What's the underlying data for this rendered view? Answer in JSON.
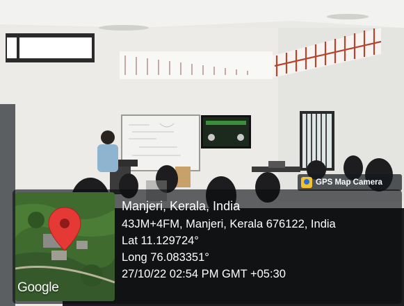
{
  "badge": {
    "icon": "gps-map-camera-icon",
    "label": "GPS Map Camera"
  },
  "map": {
    "logo": "Google",
    "pin_icon": "map-pin-icon"
  },
  "geotag": {
    "location": "Manjeri, Kerala, India",
    "address": "43JM+4FM, Manjeri, Kerala 676122, India",
    "lat": "Lat 11.129724°",
    "long": "Long 76.083351°",
    "datetime": "27/10/22 02:54 PM GMT +05:30"
  },
  "colors": {
    "pin": "#e53935",
    "panel": "#0a0c0e",
    "map_green": "#3f6b2e"
  }
}
